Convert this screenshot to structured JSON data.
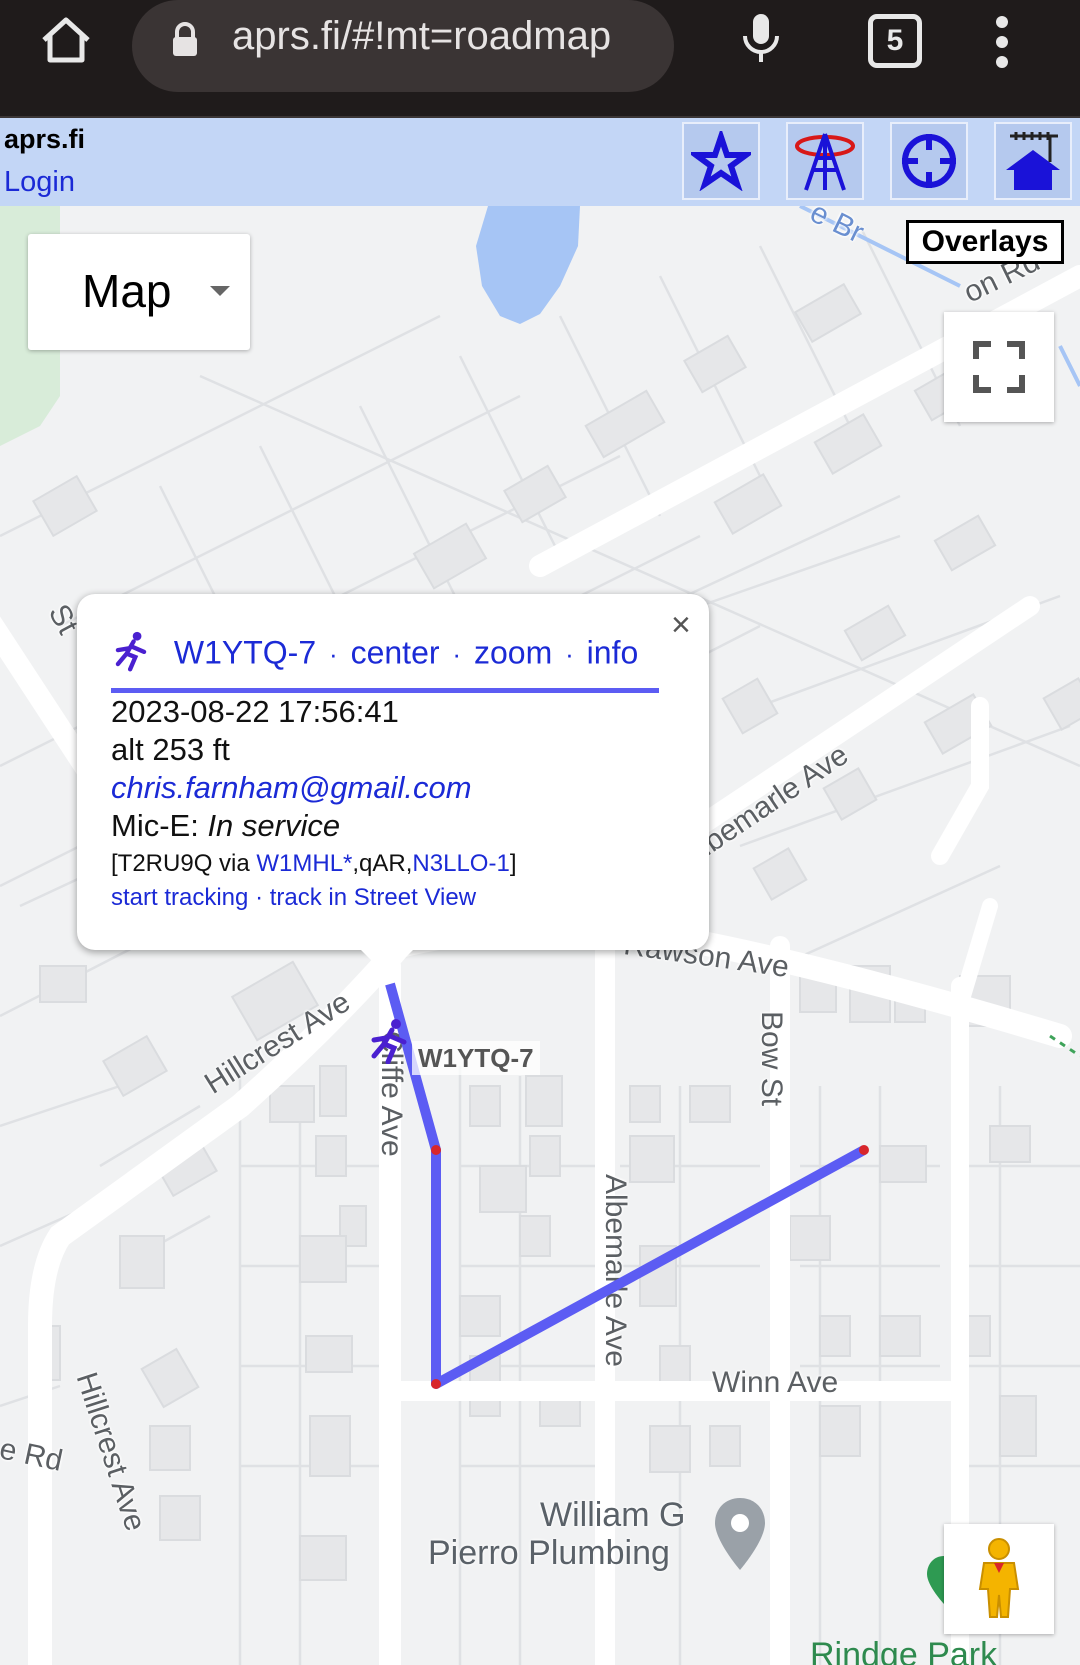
{
  "browser": {
    "url": "aprs.fi/#!mt=roadmap",
    "tab_count": "5",
    "icons": [
      "home-icon",
      "lock-icon",
      "mic-icon",
      "tabs-icon",
      "more-vert-icon"
    ]
  },
  "header": {
    "site_title": "aprs.fi",
    "login": "Login",
    "buttons": [
      "star-icon",
      "tower-icon",
      "crosshair-icon",
      "house-antenna-icon"
    ]
  },
  "map": {
    "map_type": "Map",
    "overlays": "Overlays",
    "streets": {
      "rawson": "Rawson Ave",
      "hillcrest": "Hillcrest Ave",
      "cliffe": "Cliffe Ave",
      "bow": "Bow St",
      "albemarle_upper": "lbemarle Ave",
      "albemarle_lower": "Albemarle Ave",
      "winn": "Winn Ave",
      "hillcrest_lower": "Hillcrest Ave",
      "rd_left": "e Rd",
      "st_left": "St",
      "rd_top": "on Rd",
      "brook": "e Br"
    },
    "poi": {
      "line1": "William G",
      "line2": "Pierro Plumbing"
    },
    "park": "Rindge Park",
    "station_label": "W1YTQ-7"
  },
  "info": {
    "callsign": "W1YTQ-7",
    "center": "center",
    "zoom": "zoom",
    "info": "info",
    "sep": "·",
    "timestamp": "2023-08-22 17:56:41",
    "alt": "alt 253 ft",
    "email": "chris.farnham@gmail.com",
    "mice_prefix": "Mic-E: ",
    "mice_status": "In service",
    "path_prefix": "[T2RU9Q via ",
    "path_digi": "W1MHL*",
    "path_mid": ",qAR,",
    "path_igate": "N3LLO-1",
    "path_suffix": "]",
    "start_tracking": "start tracking",
    "street_view": "track in Street View",
    "close": "×"
  },
  "colors": {
    "track": "#5c5cf3",
    "link": "#1b2ad6",
    "header_bg": "#c3d6f6"
  }
}
